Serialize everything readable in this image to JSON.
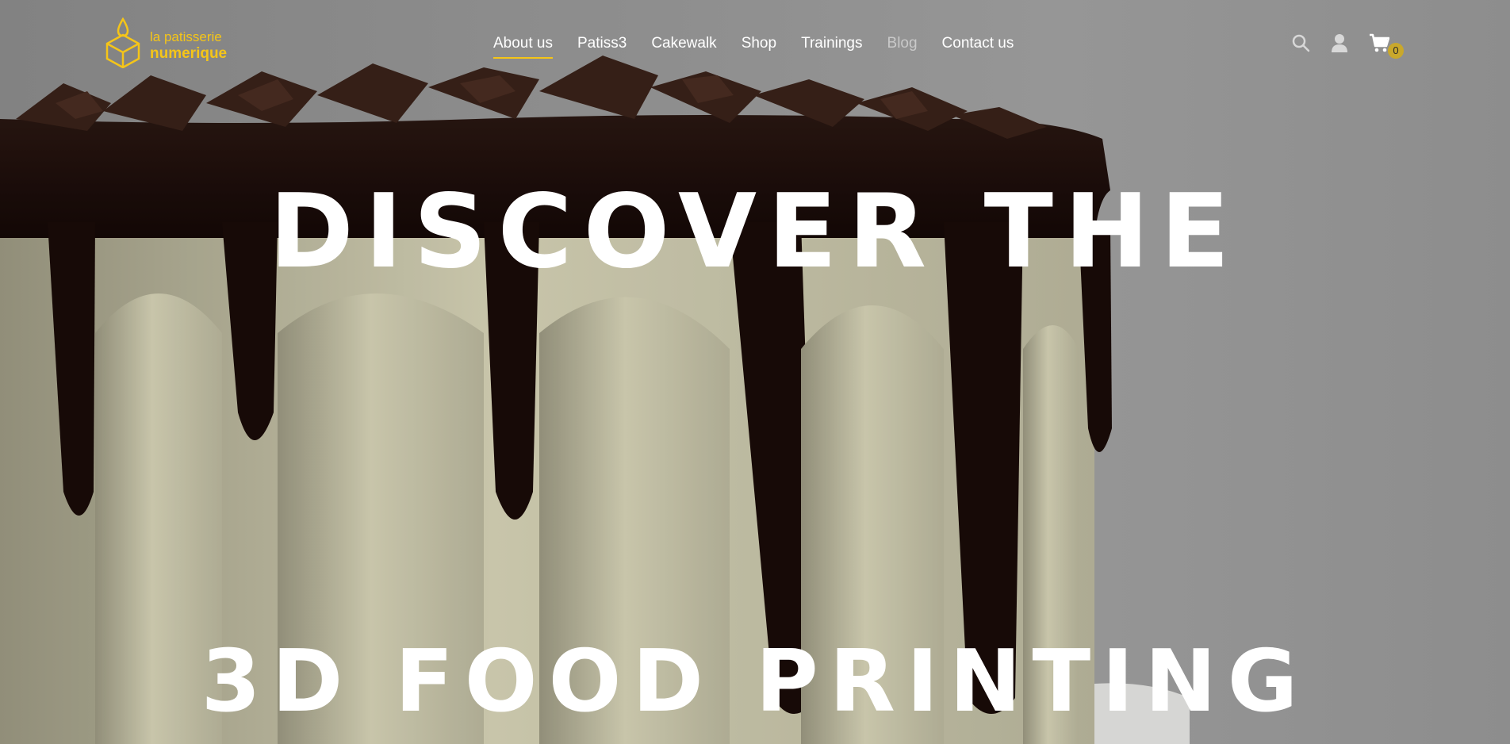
{
  "brand": {
    "line1": "la patisserie",
    "line2": "numerique",
    "color": "#f5c518"
  },
  "nav": [
    {
      "label": "About us",
      "state": "active"
    },
    {
      "label": "Patiss3",
      "state": "normal"
    },
    {
      "label": "Cakewalk",
      "state": "normal"
    },
    {
      "label": "Shop",
      "state": "normal"
    },
    {
      "label": "Trainings",
      "state": "normal"
    },
    {
      "label": "Blog",
      "state": "muted"
    },
    {
      "label": "Contact us",
      "state": "normal"
    }
  ],
  "header_icons": {
    "search": "search-icon",
    "account": "user-icon",
    "cart": "cart-icon",
    "cart_count": "0"
  },
  "hero": {
    "headline_top": "DISCOVER THE",
    "headline_bottom": "3D FOOD PRINTING"
  }
}
